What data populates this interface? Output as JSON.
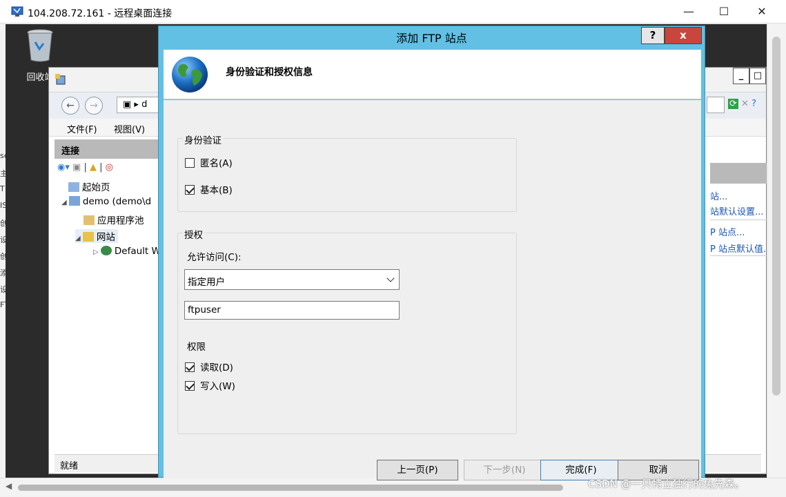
{
  "rdp": {
    "title": "104.208.72.161 - 远程桌面连接",
    "minimize": "—",
    "maximize": "☐",
    "close": "✕"
  },
  "desktop": {
    "recycle_bin_label": "回收站"
  },
  "iis": {
    "address_fragment": "d",
    "menu": [
      "文件(F)",
      "视图(V)"
    ],
    "connections_header": "连接",
    "tree": [
      {
        "label": "起始页"
      },
      {
        "label": "demo (demo\\d"
      },
      {
        "label": "应用程序池"
      },
      {
        "label": "网站"
      },
      {
        "label": "Default W"
      }
    ],
    "actions": [
      "站...",
      "站默认设置...",
      "P 站点...",
      "P 站点默认值..."
    ],
    "status": "就绪"
  },
  "dialog": {
    "title": "添加 FTP 站点",
    "help": "?",
    "close": "x",
    "banner_title": "身份验证和授权信息",
    "authentication": {
      "label": "身份验证",
      "anonymous": {
        "label": "匿名(A)",
        "checked": false
      },
      "basic": {
        "label": "基本(B)",
        "checked": true
      }
    },
    "authorization": {
      "label": "授权",
      "allow_access_label": "允许访问(C):",
      "allow_access_value": "指定用户",
      "users_value": "ftpuser",
      "permissions_label": "权限",
      "read": {
        "label": "读取(D)",
        "checked": true
      },
      "write": {
        "label": "写入(W)",
        "checked": true
      }
    },
    "buttons": {
      "previous": "上一页(P)",
      "next": "下一步(N)",
      "finish": "完成(F)",
      "cancel": "取消"
    }
  },
  "left_strip_chars": [
    "se",
    "主",
    "T",
    "IS",
    "创",
    "设",
    "创",
    "添",
    "设",
    "FT"
  ],
  "watermark": "CSDN @一只特立独行的兔先森。",
  "colors": {
    "dialog_frame": "#62c0e4",
    "close_button": "#c9463d",
    "desktop": "#2b2b2b"
  }
}
